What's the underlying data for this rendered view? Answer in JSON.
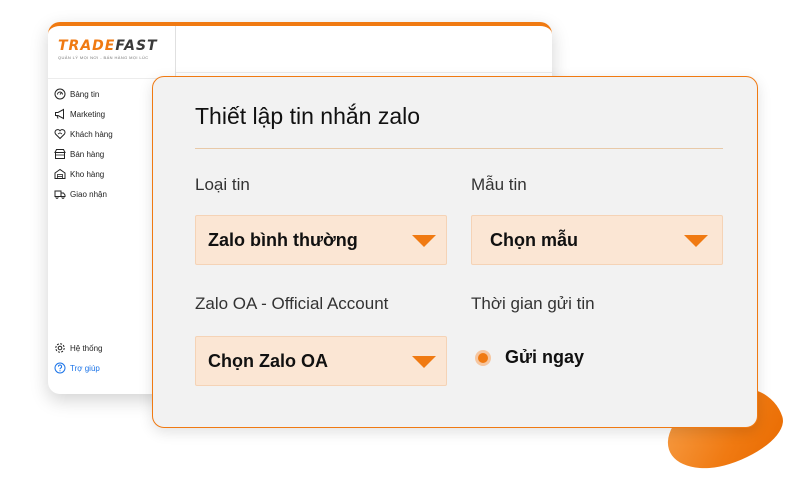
{
  "brand": {
    "logo_part1": "TRADE",
    "logo_part2": "FAST",
    "tagline": "QUẢN LÝ MỌI NƠI - BÁN HÀNG MỌI LÚC",
    "accent": "#f07a12"
  },
  "sidebar": {
    "items": [
      {
        "label": "Bảng tin",
        "icon": "dashboard-icon"
      },
      {
        "label": "Marketing",
        "icon": "megaphone-icon"
      },
      {
        "label": "Khách hàng",
        "icon": "heart-handshake-icon"
      },
      {
        "label": "Bán hàng",
        "icon": "shop-icon"
      },
      {
        "label": "Kho hàng",
        "icon": "warehouse-icon"
      },
      {
        "label": "Giao nhận",
        "icon": "truck-icon"
      }
    ],
    "bottom_items": [
      {
        "label": "Hệ thống",
        "icon": "gear-icon"
      },
      {
        "label": "Trợ giúp",
        "icon": "help-icon"
      }
    ]
  },
  "dialog": {
    "title": "Thiết lập tin nhắn zalo",
    "message_type": {
      "label": "Loại tin",
      "value": "Zalo bình thường"
    },
    "template": {
      "label": "Mẫu tin",
      "value": "Chọn mẫu"
    },
    "official_account": {
      "label": "Zalo OA - Official Account",
      "value": "Chọn Zalo OA"
    },
    "send_time": {
      "label": "Thời gian gửi tin",
      "option": "Gửi ngay",
      "selected": true
    }
  }
}
